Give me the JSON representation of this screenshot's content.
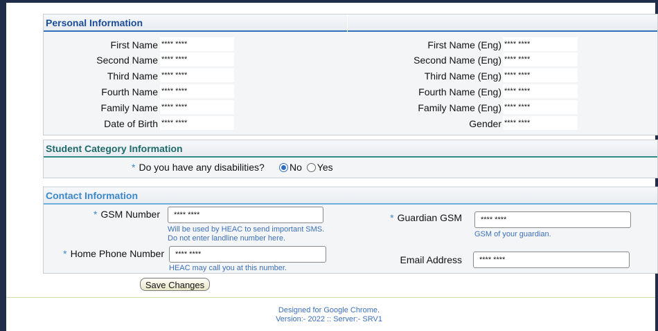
{
  "personal": {
    "title": "Personal Information",
    "left_rows": [
      {
        "label": "First Name",
        "value": "**** ****"
      },
      {
        "label": "Second Name",
        "value": "**** ****"
      },
      {
        "label": "Third Name",
        "value": "**** ****"
      },
      {
        "label": "Fourth Name",
        "value": "**** ****"
      },
      {
        "label": "Family Name",
        "value": "**** ****"
      },
      {
        "label": "Date of Birth",
        "value": "**** ****"
      }
    ],
    "right_rows": [
      {
        "label": "First Name (Eng)",
        "value": "**** ****"
      },
      {
        "label": "Second Name (Eng)",
        "value": "**** ****"
      },
      {
        "label": "Third Name (Eng)",
        "value": "**** ****"
      },
      {
        "label": "Fourth Name (Eng)",
        "value": "**** ****"
      },
      {
        "label": "Family Name (Eng)",
        "value": "**** ****"
      },
      {
        "label": "Gender",
        "value": "**** ****"
      }
    ]
  },
  "category": {
    "title": "Student Category Information",
    "question": "Do you have any disabilities?",
    "required_mark": "*",
    "options": [
      {
        "label": "No",
        "selected": true
      },
      {
        "label": "Yes",
        "selected": false
      }
    ]
  },
  "contact": {
    "title": "Contact Information",
    "required_mark": "*",
    "gsm": {
      "label": "GSM Number",
      "value": "**** ****",
      "hint": "Will be used by HEAC to send important SMS. Do not enter landline number here."
    },
    "home_phone": {
      "label": "Home Phone Number",
      "value": "**** ****",
      "hint": "HEAC may call you at this number."
    },
    "guardian_gsm": {
      "label": "Guardian GSM",
      "value": "**** ****",
      "hint": "GSM of your guardian."
    },
    "email": {
      "label": "Email Address",
      "value": "**** ****"
    }
  },
  "save_button": "Save Changes",
  "footer": {
    "line1": "Designed for Google Chrome.",
    "line2": "Version:- 2022 :: Server:- SRV1"
  }
}
